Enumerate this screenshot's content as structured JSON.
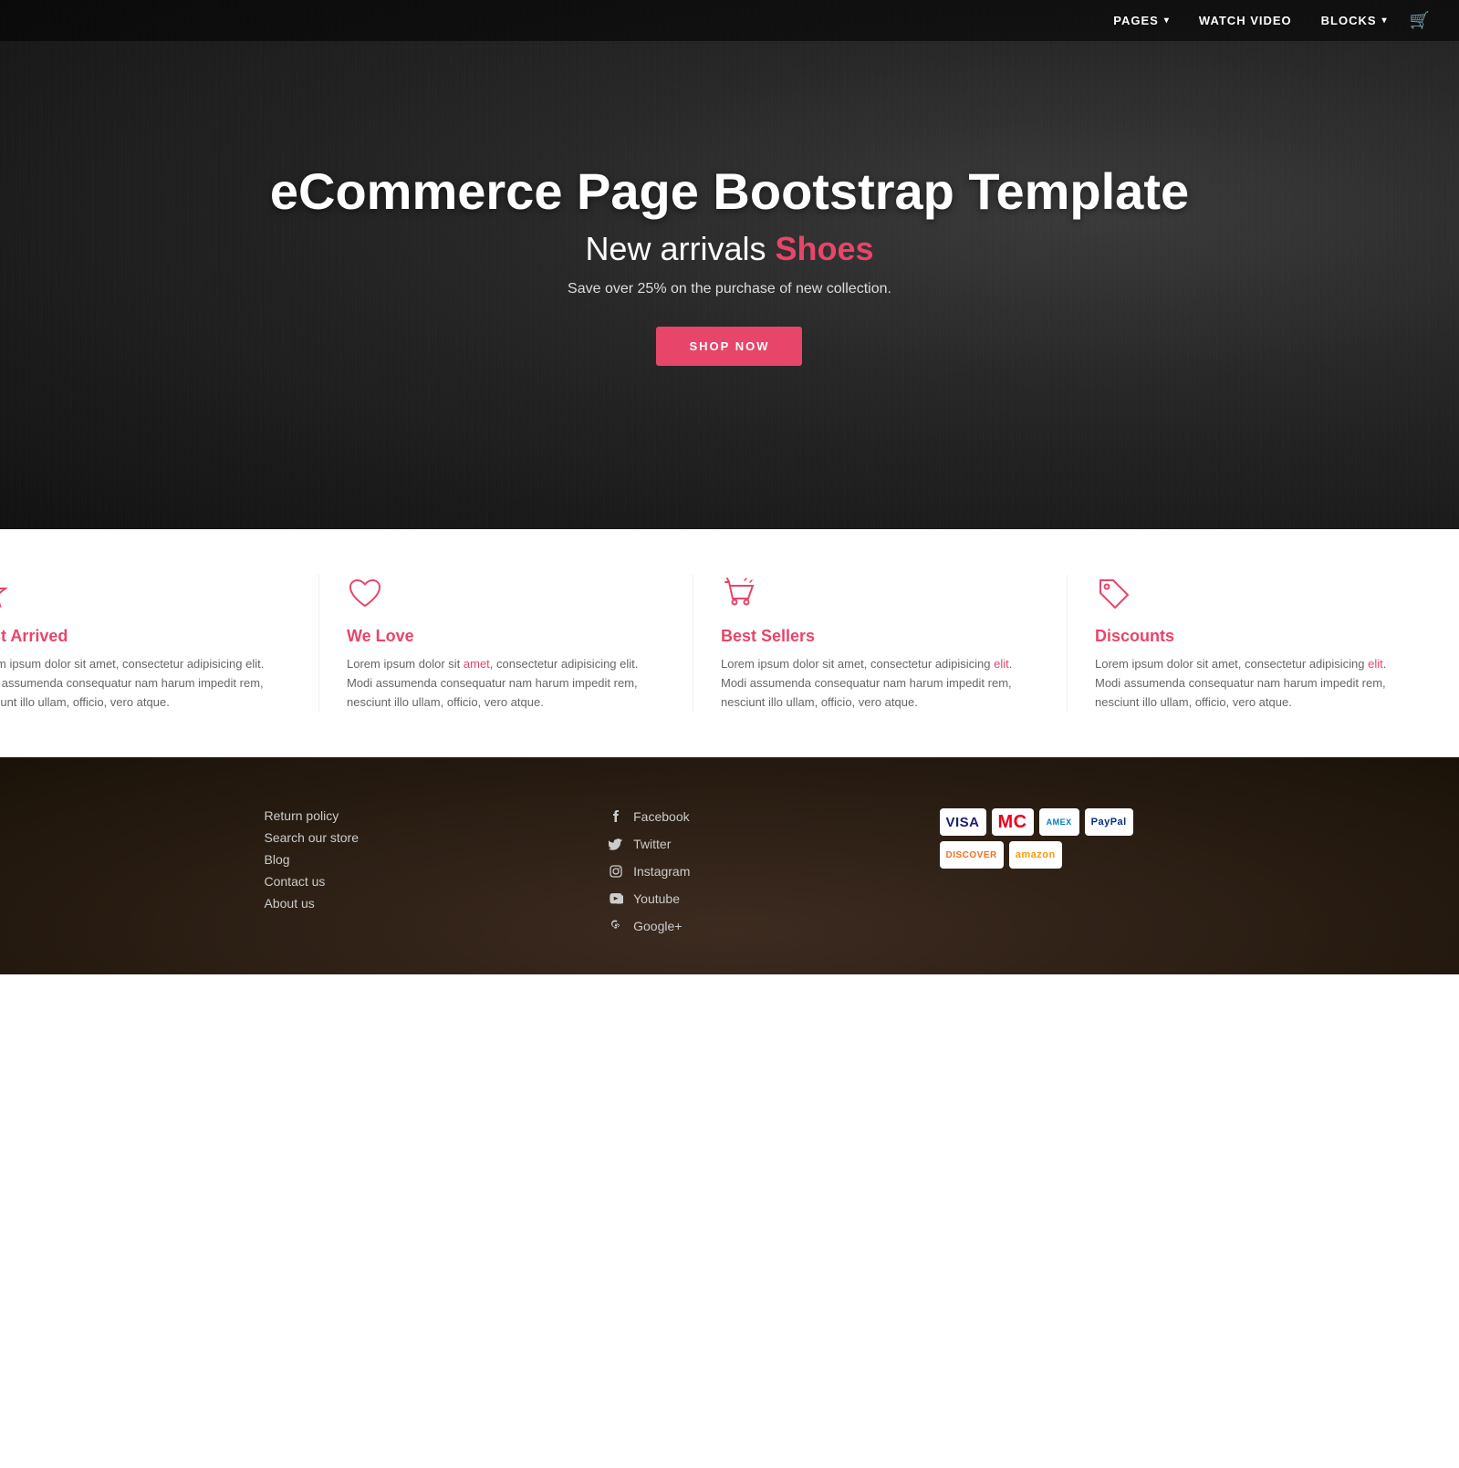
{
  "navbar": {
    "items": [
      {
        "label": "PAGES",
        "has_dropdown": true
      },
      {
        "label": "WATCH VIDEO",
        "has_dropdown": false
      },
      {
        "label": "BLOCKS",
        "has_dropdown": true
      }
    ]
  },
  "hero": {
    "title": "eCommerce Page Bootstrap Template",
    "subtitle_plain": "New arrivals ",
    "subtitle_highlight": "Shoes",
    "description": "Save over 25% on the purchase of new collection.",
    "cta_label": "SHOP NOW"
  },
  "features": [
    {
      "id": "just-arrived",
      "icon": "star-icon",
      "title": "Just Arrived",
      "text": "Lorem ipsum dolor sit amet, consectetur adipisicing elit. Modi assumenda consequatur nam harum impedit rem, nesciunt illo ullam, officio, vero atque.",
      "link_word": "amet"
    },
    {
      "id": "we-love",
      "icon": "heart-icon",
      "title": "We Love",
      "text": "Lorem ipsum dolor sit amet, consectetur adipisicing elit. Modi assumenda consequatur nam harum impedit rem, nesciunt illo ullam, officio, vero atque.",
      "link_word": "amet"
    },
    {
      "id": "best-sellers",
      "icon": "cart-icon",
      "title": "Best Sellers",
      "text": "Lorem ipsum dolor sit amet, consectetur adipisicing elit. Modi assumenda consequatur nam harum impedit rem, nesciunt illo ullam, officio, vero atque.",
      "link_word": "elit"
    },
    {
      "id": "discounts",
      "icon": "tag-icon",
      "title": "Discounts",
      "text": "Lorem ipsum dolor sit amet, consectetur adipisicing elit. Modi assumenda consequatur nam harum impedit rem, nesciunt illo ullam, officio, vero atque.",
      "link_word": "elit"
    }
  ],
  "footer": {
    "links": [
      {
        "label": "Return policy"
      },
      {
        "label": "Search our store"
      },
      {
        "label": "Blog"
      },
      {
        "label": "Contact us"
      },
      {
        "label": "About us"
      }
    ],
    "social": [
      {
        "platform": "Facebook",
        "icon": "facebook-icon"
      },
      {
        "platform": "Twitter",
        "icon": "twitter-icon"
      },
      {
        "platform": "Instagram",
        "icon": "instagram-icon"
      },
      {
        "platform": "Youtube",
        "icon": "youtube-icon"
      },
      {
        "platform": "Google+",
        "icon": "googleplus-icon"
      }
    ],
    "payments": [
      {
        "label": "VISA",
        "class": "visa"
      },
      {
        "label": "MC",
        "class": "mc"
      },
      {
        "label": "AMEX",
        "class": "amex"
      },
      {
        "label": "PayPal",
        "class": "paypal"
      },
      {
        "label": "DISCOVER",
        "class": "discover"
      },
      {
        "label": "amazon",
        "class": "amazon"
      }
    ]
  }
}
